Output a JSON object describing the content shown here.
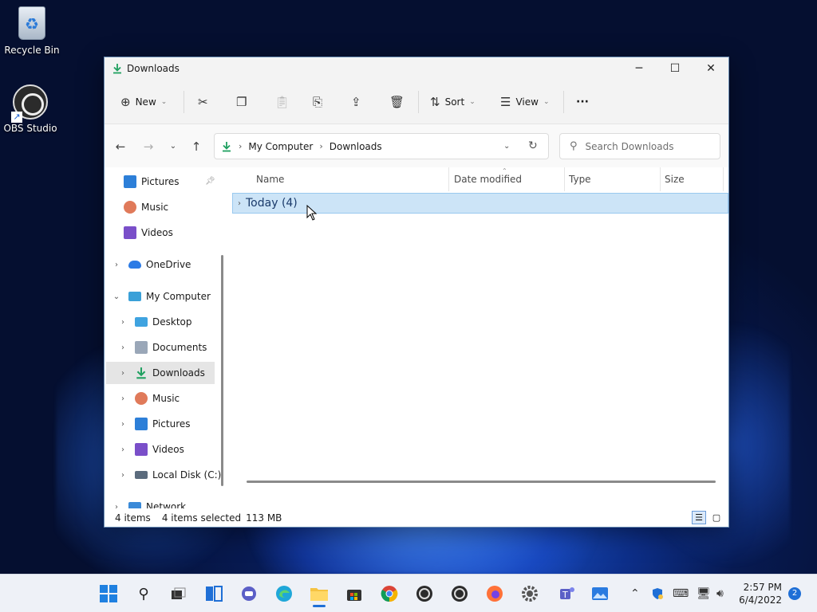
{
  "desktop": {
    "icons": [
      {
        "label": "Recycle Bin",
        "icon": "recycle-bin-icon"
      },
      {
        "label": "OBS Studio",
        "icon": "obs-studio-icon"
      }
    ]
  },
  "window": {
    "title": "Downloads",
    "controls": {
      "minimize": "─",
      "maximize": "☐",
      "close": "✕"
    }
  },
  "toolbar": {
    "new_label": "New",
    "sort_label": "Sort",
    "view_label": "View",
    "more_label": "···"
  },
  "address": {
    "segments": [
      "My Computer",
      "Downloads"
    ],
    "search_placeholder": "Search Downloads"
  },
  "nav": {
    "quick_access": [
      "Pictures",
      "Music",
      "Videos"
    ],
    "onedrive": "OneDrive",
    "my_computer": "My Computer",
    "my_computer_children": [
      "Desktop",
      "Documents",
      "Downloads",
      "Music",
      "Pictures",
      "Videos",
      "Local Disk (C:)"
    ],
    "network": "Network"
  },
  "columns": {
    "name": "Name",
    "date": "Date modified",
    "type": "Type",
    "size": "Size"
  },
  "group": {
    "label": "Today (4)"
  },
  "status": {
    "items": "4 items",
    "selected": "4 items selected",
    "size": "113 MB"
  },
  "taskbar": {
    "time": "2:57 PM",
    "date": "6/4/2022",
    "notifications": "2"
  },
  "colors": {
    "accent": "#1f6fd6",
    "selection": "#cce4f7",
    "download_green": "#1fa060"
  }
}
